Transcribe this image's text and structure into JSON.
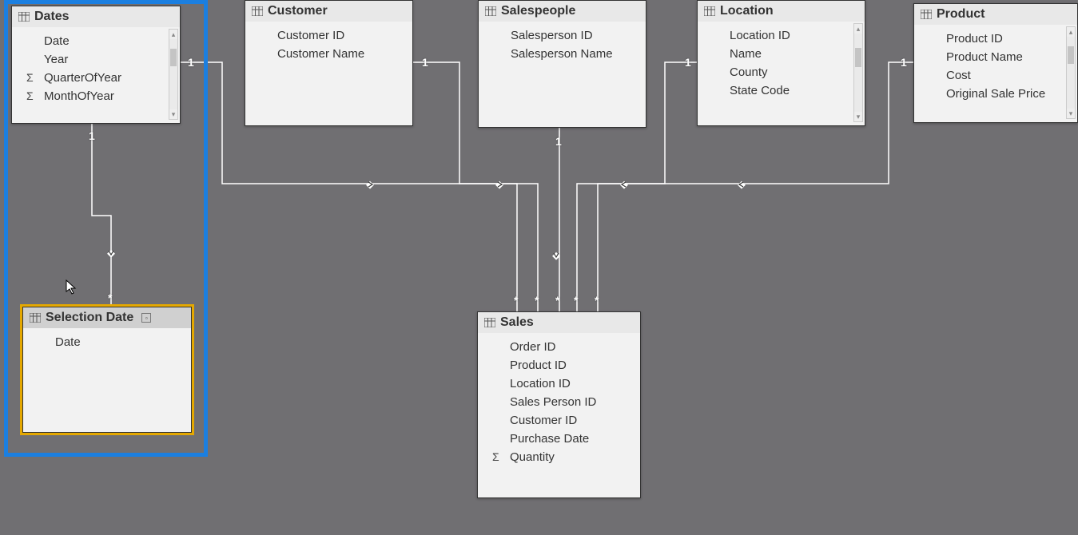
{
  "tables": {
    "dates": {
      "title": "Dates",
      "fields": [
        "Date",
        "Year",
        "QuarterOfYear",
        "MonthOfYear"
      ],
      "sigma": [
        false,
        false,
        true,
        true
      ]
    },
    "customer": {
      "title": "Customer",
      "fields": [
        "Customer ID",
        "Customer Name"
      ]
    },
    "salespeople": {
      "title": "Salespeople",
      "fields": [
        "Salesperson ID",
        "Salesperson Name"
      ]
    },
    "location": {
      "title": "Location",
      "fields": [
        "Location ID",
        "Name",
        "County",
        "State Code"
      ]
    },
    "product": {
      "title": "Product",
      "fields": [
        "Product ID",
        "Product Name",
        "Cost",
        "Original Sale Price"
      ],
      "sigma": [
        false,
        false,
        false,
        false
      ]
    },
    "selection_date": {
      "title": "Selection Date",
      "fields": [
        "Date"
      ]
    },
    "sales": {
      "title": "Sales",
      "fields": [
        "Order ID",
        "Product ID",
        "Location ID",
        "Sales Person ID",
        "Customer ID",
        "Purchase Date",
        "Quantity"
      ],
      "sigma": [
        false,
        false,
        false,
        false,
        false,
        false,
        true
      ]
    }
  },
  "cardinality": {
    "one": "1",
    "many": "*"
  }
}
